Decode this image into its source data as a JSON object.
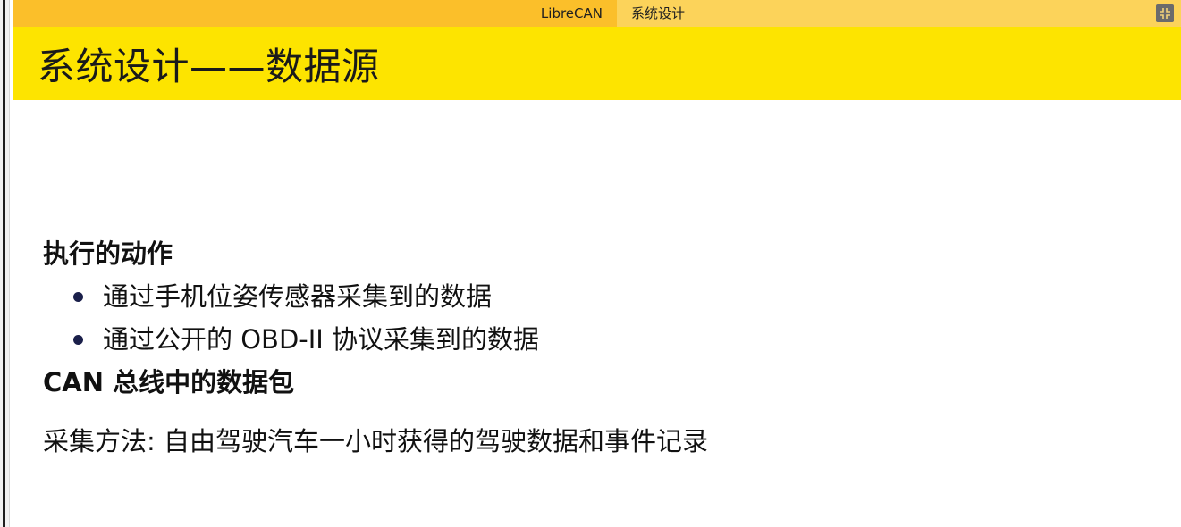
{
  "headline": {
    "left_section": "LibreCAN",
    "right_section": "系统设计"
  },
  "frame": {
    "title": "系统设计——数据源"
  },
  "body": {
    "heading_actions": "执行的动作",
    "bullets": [
      "通过手机位姿传感器采集到的数据",
      "通过公开的 OBD-II 协议采集到的数据"
    ],
    "heading_can": "CAN 总线中的数据包",
    "method": "采集方法: 自由驾驶汽车一小时获得的驾驶数据和事件记录"
  },
  "icons": {
    "fullscreen": "fullscreen-icon",
    "bullet": "bullet-dot-icon"
  },
  "colors": {
    "headline_left": "#fbbf2a",
    "headline_right": "#fcd35a",
    "title_bar": "#fde400",
    "bullet": "#1a1f4a"
  }
}
